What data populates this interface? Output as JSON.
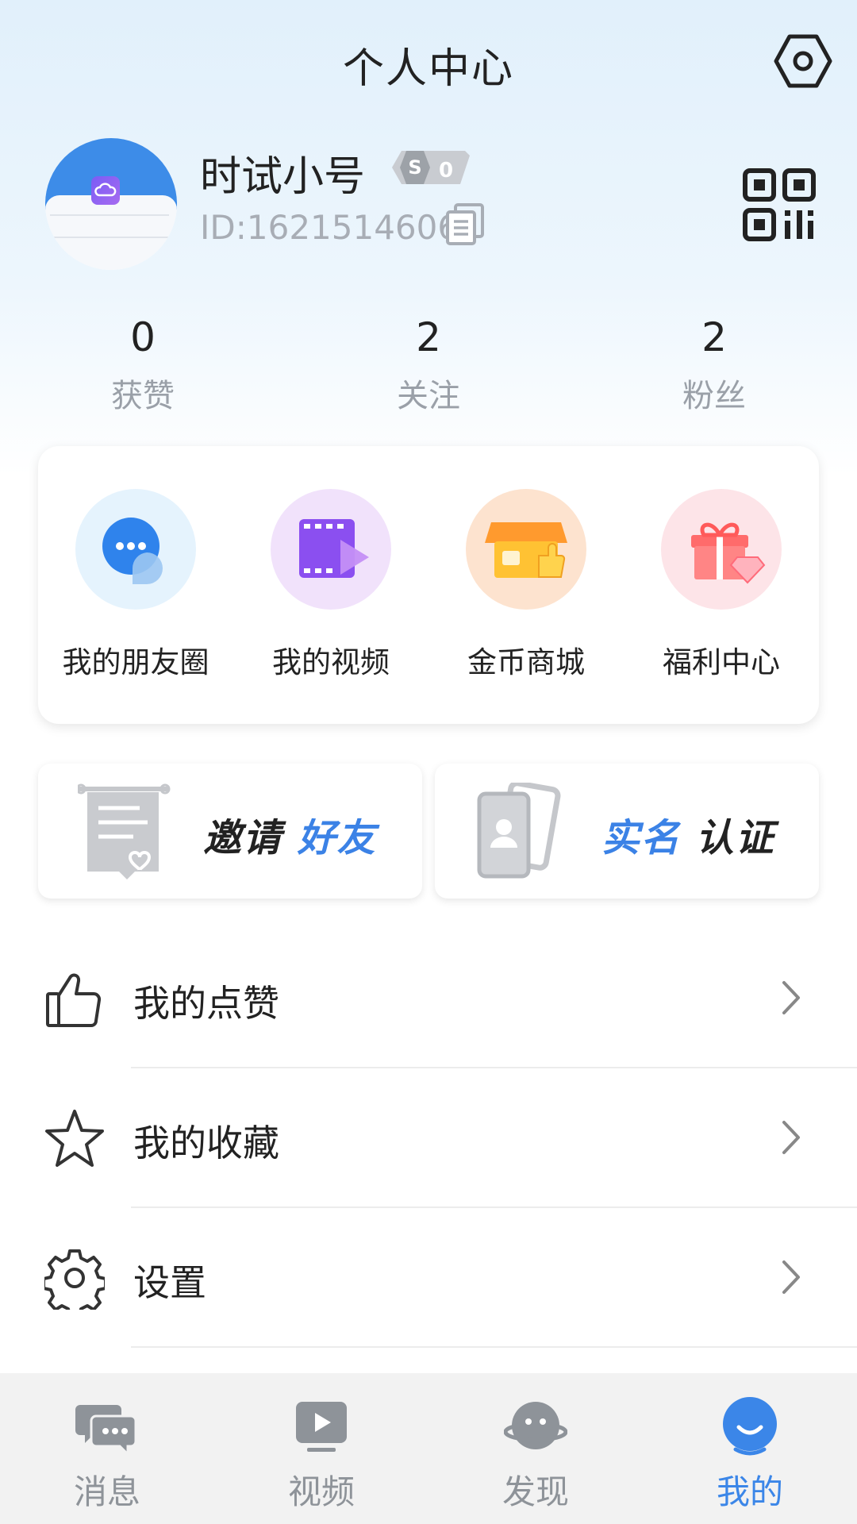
{
  "header": {
    "title": "个人中心",
    "settings_icon": "settings-hex-icon"
  },
  "profile": {
    "username": "时试小号",
    "level": "0",
    "user_id": "ID:1621514606"
  },
  "stats": [
    {
      "value": "0",
      "label": "获赞"
    },
    {
      "value": "2",
      "label": "关注"
    },
    {
      "value": "2",
      "label": "粉丝"
    }
  ],
  "quick_actions": [
    {
      "label": "我的朋友圈",
      "icon": "chat-bubble-icon",
      "bg": "#e5f3fd"
    },
    {
      "label": "我的视频",
      "icon": "video-film-icon",
      "bg": "#f1e2fb"
    },
    {
      "label": "金币商城",
      "icon": "store-icon",
      "bg": "#fde3cf"
    },
    {
      "label": "福利中心",
      "icon": "gift-icon",
      "bg": "#fde4e8"
    }
  ],
  "banners": {
    "invite": {
      "part1": "邀请",
      "part2": "好友"
    },
    "verify": {
      "part1": "实名",
      "part2": "认证"
    }
  },
  "menu": [
    {
      "label": "我的点赞",
      "icon": "thumbs-up-icon"
    },
    {
      "label": "我的收藏",
      "icon": "star-icon"
    },
    {
      "label": "设置",
      "icon": "gear-icon"
    }
  ],
  "tabs": [
    {
      "label": "消息",
      "icon": "message-icon",
      "active": false
    },
    {
      "label": "视频",
      "icon": "video-icon",
      "active": false
    },
    {
      "label": "发现",
      "icon": "discover-icon",
      "active": false
    },
    {
      "label": "我的",
      "icon": "me-icon",
      "active": true
    }
  ],
  "colors": {
    "accent": "#3b86e8",
    "muted": "#9aa0a8",
    "tabbar_bg": "#f2f2f2"
  }
}
